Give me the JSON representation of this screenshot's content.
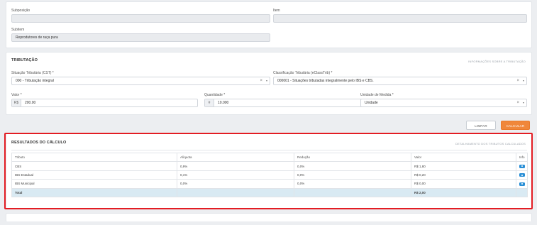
{
  "top": {
    "subposicao_label": "Subposição",
    "item_label": "Item",
    "subitem_label": "Subitem",
    "subitem_value": "Reprodutores de raça pura"
  },
  "tributacao": {
    "title": "TRIBUTAÇÃO",
    "info_link": "INFORMAÇÕES SOBRE A TRIBUTAÇÃO",
    "cst_label": "Situação Tributária (CST) *",
    "cst_value": "000 - Tributação integral",
    "cclass_label": "Classificação Tributária (eClassTrib) *",
    "cclass_value": "000001 - Situações tributadas integralmente pelo IBS e CBS.",
    "valor_label": "Valor *",
    "valor_prefix": "R$",
    "valor_value": "200.00",
    "quantidade_label": "Quantidade *",
    "quantidade_prefix": "#",
    "quantidade_value": "10.000",
    "unidade_label": "Unidade de Medida *",
    "unidade_value": "Unidade",
    "clear_symbol": "×",
    "caret_symbol": "▾"
  },
  "actions": {
    "limpar": "LIMPAR",
    "calcular": "CALCULAR"
  },
  "resultados": {
    "title": "RESULTADOS DO CÁLCULO",
    "detail_link": "DETALHAMENTO DOS TRIBUTOS CALCULADOS",
    "headers": [
      "Tributo",
      "Alíquota",
      "Redução",
      "Valor",
      "Info"
    ],
    "rows": [
      [
        "CBS",
        "0,9%",
        "0,0%",
        "R$ 1,80"
      ],
      [
        "IBS Estadual",
        "0,1%",
        "0,0%",
        "R$ 0,20"
      ],
      [
        "IBS Municipal",
        "0,0%",
        "0,0%",
        "R$ 0,00"
      ]
    ],
    "total_label": "Total",
    "total_value": "R$ 2,00"
  },
  "colors": {
    "accent_orange": "#f0873a",
    "highlight_red": "#e31c23",
    "info_blue": "#2a8fd6",
    "total_row_bg": "#d9eaf3"
  }
}
